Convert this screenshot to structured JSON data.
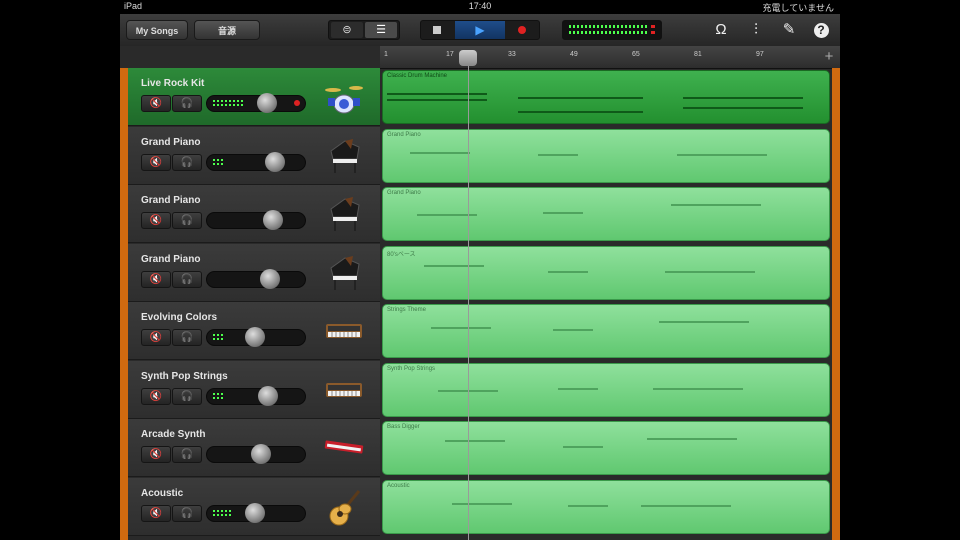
{
  "status": {
    "device": "iPad",
    "time": "17:40",
    "battery_text": "充電していません"
  },
  "toolbar": {
    "my_songs": "My Songs",
    "sound_label": "音源"
  },
  "ruler": {
    "marks": [
      "1",
      "17",
      "33",
      "49",
      "65",
      "81",
      "97"
    ]
  },
  "tracks": [
    {
      "name": "Live Rock Kit",
      "region": "Classic Drum Machine",
      "selected": true,
      "meter": 8,
      "knob": 0.62,
      "instrument": "drum-kit-icon"
    },
    {
      "name": "Grand Piano",
      "region": "Grand Piano",
      "selected": false,
      "meter": 3,
      "knob": 0.72,
      "instrument": "grand-piano-icon"
    },
    {
      "name": "Grand Piano",
      "region": "Grand Piano",
      "selected": false,
      "meter": 0,
      "knob": 0.7,
      "instrument": "grand-piano-icon"
    },
    {
      "name": "Grand Piano",
      "region": "80'sベース",
      "selected": false,
      "meter": 0,
      "knob": 0.66,
      "instrument": "grand-piano-icon"
    },
    {
      "name": "Evolving Colors",
      "region": "Strings Theme",
      "selected": false,
      "meter": 3,
      "knob": 0.47,
      "instrument": "synth-keyboard-icon"
    },
    {
      "name": "Synth Pop Strings",
      "region": "Synth Pop Strings",
      "selected": false,
      "meter": 3,
      "knob": 0.64,
      "instrument": "synth-keyboard-icon"
    },
    {
      "name": "Arcade Synth",
      "region": "Bass Digger",
      "selected": false,
      "meter": 0,
      "knob": 0.55,
      "instrument": "red-keyboard-icon"
    },
    {
      "name": "Acoustic",
      "region": "Acoustic",
      "selected": false,
      "meter": 5,
      "knob": 0.48,
      "instrument": "acoustic-guitar-icon"
    }
  ],
  "colors": {
    "selected_region": "#2b9a3a",
    "region": "#7ad88a",
    "edge": "#d06a10"
  }
}
